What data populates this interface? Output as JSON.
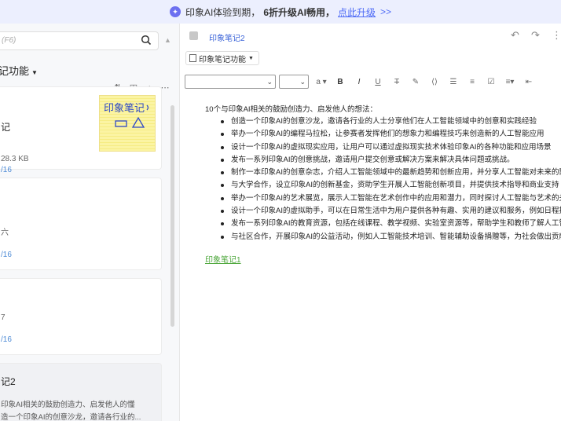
{
  "banner": {
    "icon": "sparkle-icon",
    "text": "印象AI体验到期，",
    "highlight": "6折升级AI畅用，",
    "link": "点此升级",
    "arrows": ">>"
  },
  "sidebar": {
    "search_placeholder": "(F6)",
    "notebook_title": "记功能",
    "notes": [
      {
        "title": "记",
        "meta": "28.3 KB",
        "date": "/16",
        "thumb_text": "印象笔记",
        "thumb_color": "#fbf4a3"
      },
      {
        "title": "",
        "meta": "六",
        "date": "/16"
      },
      {
        "title": "",
        "meta": "7",
        "date": "/16"
      },
      {
        "title": "记2",
        "snippet_1": "印象AI相关的鼓励创造力、启发他人的懂",
        "snippet_2": "造一个印象AI的创意沙龙，邀请各行业的..."
      }
    ]
  },
  "note": {
    "breadcrumb": "印象笔记2",
    "notebook_select": "印象笔记功能",
    "intro": "10个与印象AI相关的鼓励创造力、启发他人的想法：",
    "bullets": [
      "创造一个印象AI的创意沙龙，邀请各行业的人士分享他们在人工智能领域中的创意和实践经验",
      "举办一个印象AI的编程马拉松，让参赛者发挥他们的想象力和编程技巧来创造新的人工智能应用",
      "设计一个印象AI的虚拟现实应用，让用户可以通过虚拟现实技术体验印象AI的各种功能和应用场景",
      "发布一系列印象AI的创意挑战，邀请用户提交创意或解决方案来解决具体问题或挑战。",
      "制作一本印象AI的创意杂志，介绍人工智能领域中的最新趋势和创新应用，并分享人工智能对未来的影响",
      "与大学合作，设立印象AI的创新基金，资助学生开展人工智能创新项目，并提供技术指导和商业支持",
      "举办一个印象AI的艺术展览，展示人工智能在艺术创作中的应用和潜力，同时探讨人工智能与艺术的关系",
      "设计一个印象AI的虚拟助手，可以在日常生活中为用户提供各种有趣、实用的建议和服务，例如日程提醒",
      "发布一系列印象AI的教育资源，包括在线课程、教学视频、实验室资源等，帮助学生和教师了解人工智能",
      "与社区合作，开展印象AI的公益活动，例如人工智能技术培训、智能辅助设备捐赠等，为社会做出贡献"
    ],
    "link": "印象笔记1"
  },
  "colors": {
    "banner_bg": "#eceffe",
    "accent": "#4e6bf6",
    "link_green": "#4fa83d",
    "date_blue": "#4e8bd6"
  }
}
